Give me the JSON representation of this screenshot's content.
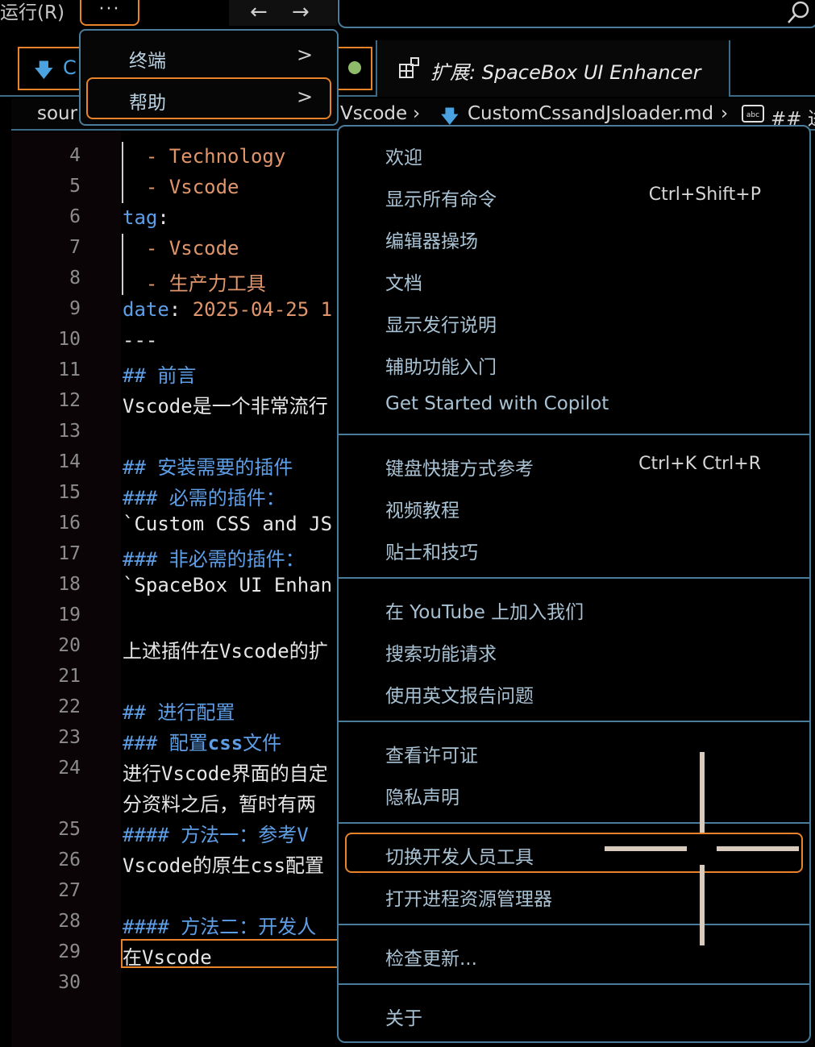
{
  "topbar": {
    "run_menu": "运行(R)",
    "more_label": "···",
    "back_arrow": "←",
    "forward_arrow": "→",
    "search_icon": "search-icon"
  },
  "tabs": {
    "left_tab_initial": "C",
    "extension_tab_label": "扩展: SpaceBox UI Enhancer"
  },
  "breadcrumb": {
    "first": "sour",
    "folder": "Vscode",
    "file": "CustomCssandJsloader.md",
    "heading": "## 进"
  },
  "editor": {
    "lines": [
      {
        "n": "4"
      },
      {
        "n": "5"
      },
      {
        "n": "6"
      },
      {
        "n": "7"
      },
      {
        "n": "8"
      },
      {
        "n": "9"
      },
      {
        "n": "10"
      },
      {
        "n": "11"
      },
      {
        "n": "12"
      },
      {
        "n": "13"
      },
      {
        "n": "14"
      },
      {
        "n": "15"
      },
      {
        "n": "16"
      },
      {
        "n": "17"
      },
      {
        "n": "18"
      },
      {
        "n": "19"
      },
      {
        "n": "20"
      },
      {
        "n": "21"
      },
      {
        "n": "22"
      },
      {
        "n": "23"
      },
      {
        "n": "24"
      },
      {
        "n": "25"
      },
      {
        "n": "26"
      },
      {
        "n": "27"
      },
      {
        "n": "28"
      },
      {
        "n": "29"
      },
      {
        "n": "30"
      }
    ],
    "code": {
      "l4": "  - Technology",
      "l5": "  - Vscode",
      "l6_key": "tag",
      "l6_colon": ":",
      "l7": "  - Vscode",
      "l8": "  - 生产力工具",
      "l9_key": "date",
      "l9_colon": ": ",
      "l9_val": "2025-04-25 1",
      "l10": "---",
      "l11": "## 前言",
      "l12": "Vscode是一个非常流行",
      "l14": "## 安装需要的插件",
      "l15": "### 必需的插件：",
      "l16": "`Custom CSS and JS",
      "l17": "### 非必需的插件：",
      "l18": "`SpaceBox UI Enhan",
      "l20": "上述插件在Vscode的扩",
      "l22": "## 进行配置",
      "l23_a": "### 配置",
      "l23_b": "css",
      "l23_c": "文件",
      "l24a": "进行Vscode界面的自定",
      "l24b": "分资料之后，暂时有两",
      "l25": "#### 方法一：参考V",
      "l26": "Vscode的原生css配置",
      "l28": "#### 方法二：开发人",
      "l29": "在Vscode"
    }
  },
  "menu_top": {
    "items": [
      {
        "label": "终端",
        "chevron": ">"
      },
      {
        "label": "帮助",
        "chevron": ">"
      }
    ]
  },
  "menu_help": {
    "groups": [
      [
        {
          "label": "欢迎",
          "shortcut": ""
        },
        {
          "label": "显示所有命令",
          "shortcut": "Ctrl+Shift+P"
        },
        {
          "label": "编辑器操场",
          "shortcut": ""
        },
        {
          "label": "文档",
          "shortcut": ""
        },
        {
          "label": "显示发行说明",
          "shortcut": ""
        },
        {
          "label": "辅助功能入门",
          "shortcut": ""
        },
        {
          "label": "Get Started with Copilot",
          "shortcut": ""
        }
      ],
      [
        {
          "label": "键盘快捷方式参考",
          "shortcut": "Ctrl+K Ctrl+R"
        },
        {
          "label": "视频教程",
          "shortcut": ""
        },
        {
          "label": "贴士和技巧",
          "shortcut": ""
        }
      ],
      [
        {
          "label": "在 YouTube 上加入我们",
          "shortcut": ""
        },
        {
          "label": "搜索功能请求",
          "shortcut": ""
        },
        {
          "label": "使用英文报告问题",
          "shortcut": ""
        }
      ],
      [
        {
          "label": "查看许可证",
          "shortcut": ""
        },
        {
          "label": "隐私声明",
          "shortcut": ""
        }
      ],
      [
        {
          "label": "切换开发人员工具",
          "shortcut": ""
        },
        {
          "label": "打开进程资源管理器",
          "shortcut": ""
        }
      ],
      [
        {
          "label": "检查更新...",
          "shortcut": ""
        }
      ],
      [
        {
          "label": "关于",
          "shortcut": ""
        }
      ]
    ]
  },
  "colors": {
    "accent_orange": "#e8832a",
    "border_blue": "#4a7d9c",
    "code_key": "#5d9ee6",
    "code_value": "#e0956a"
  }
}
